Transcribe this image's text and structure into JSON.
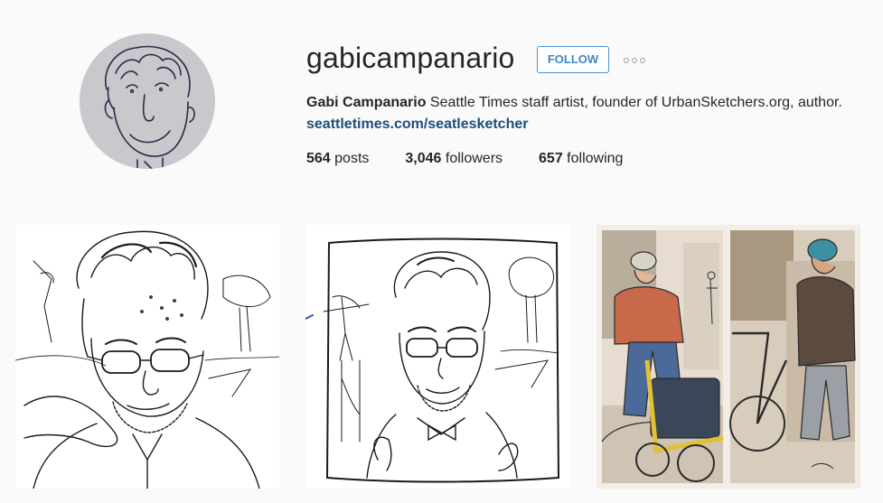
{
  "profile": {
    "username": "gabicampanario",
    "follow_label": "FOLLOW",
    "display_name": "Gabi Campanario",
    "bio_text": " Seattle Times staff artist, founder of UrbanSketchers.org, author.",
    "website": "seattletimes.com/seatlesketcher"
  },
  "stats": {
    "posts_count": "564",
    "posts_label": " posts",
    "followers_count": "3,046",
    "followers_label": " followers",
    "following_count": "657",
    "following_label": " following"
  },
  "icons": {
    "more": "more-options-icon"
  },
  "colors": {
    "follow_blue": "#3d86c6",
    "link_blue": "#1c4d7b",
    "background": "#fafafa"
  }
}
